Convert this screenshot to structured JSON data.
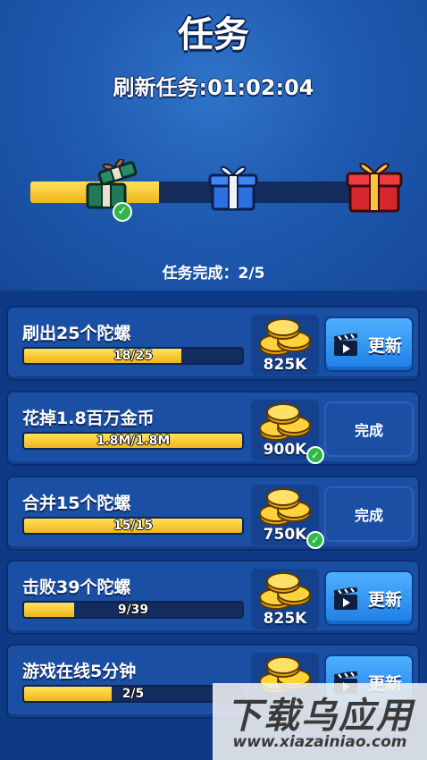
{
  "header": {
    "title": "任务",
    "refresh_label": "刷新任务:",
    "refresh_timer": "01:02:04",
    "progress_fraction": 0.37,
    "completed_label": "任务完成：2/5"
  },
  "gifts": [
    {
      "name": "green-gift",
      "opened": true
    },
    {
      "name": "blue-gift",
      "opened": false
    },
    {
      "name": "red-gift",
      "opened": false
    }
  ],
  "tasks": [
    {
      "title": "刷出25个陀螺",
      "progress_text": "18/25",
      "progress": 0.72,
      "reward": "825K",
      "claimed": false,
      "button": "更新"
    },
    {
      "title": "花掉1.8百万金币",
      "progress_text": "1.8M/1.8M",
      "progress": 1.0,
      "reward": "900K",
      "claimed": true,
      "button": "完成"
    },
    {
      "title": "合并15个陀螺",
      "progress_text": "15/15",
      "progress": 1.0,
      "reward": "750K",
      "claimed": true,
      "button": "完成"
    },
    {
      "title": "击败39个陀螺",
      "progress_text": "9/39",
      "progress": 0.23,
      "reward": "825K",
      "claimed": false,
      "button": "更新"
    },
    {
      "title": "游戏在线5分钟",
      "progress_text": "2/5",
      "progress": 0.4,
      "reward": "",
      "claimed": false,
      "button": "更新"
    }
  ],
  "watermark": {
    "text": "下载乌应用",
    "url": "www.xiazainiao.com"
  },
  "colors": {
    "bar_fill": "#f0b51a",
    "refresh_button": "#1d7ee6",
    "check": "#2fb84a"
  }
}
